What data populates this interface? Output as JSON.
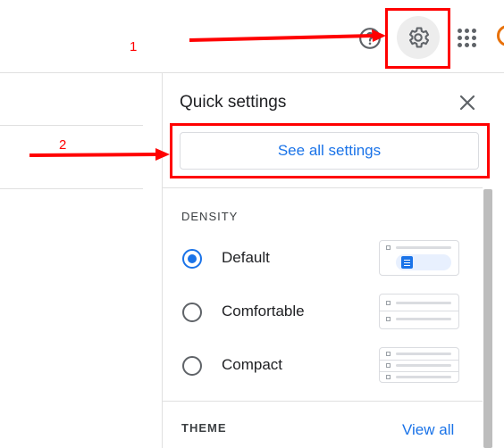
{
  "topbar": {
    "icons": {
      "help": "help-circle-icon",
      "settings": "gear-icon",
      "apps": "apps-grid-icon"
    }
  },
  "quick_settings": {
    "title": "Quick settings",
    "close_icon": "close-icon",
    "see_all_label": "See all settings",
    "density": {
      "label": "DENSITY",
      "options": [
        {
          "label": "Default",
          "checked": true
        },
        {
          "label": "Comfortable",
          "checked": false
        },
        {
          "label": "Compact",
          "checked": false
        }
      ]
    },
    "theme": {
      "label": "THEME",
      "view_all_label": "View all"
    }
  },
  "annotations": {
    "label_1": "1",
    "label_2": "2",
    "color": "#ff0000"
  },
  "colors": {
    "accent": "#1a73e8",
    "annotation": "#ff0000",
    "border": "#dadce0"
  }
}
